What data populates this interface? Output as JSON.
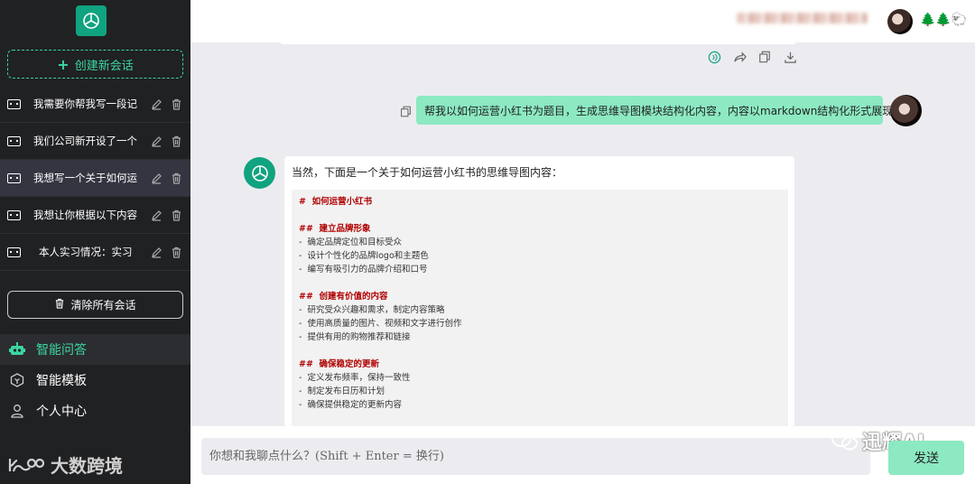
{
  "colors": {
    "accent": "#3bd6a1",
    "sidebar_bg": "#202123",
    "user_bubble": "#8ce9c2",
    "bot_green": "#10a37f",
    "heading_red": "#b00000"
  },
  "sidebar": {
    "new_chat_label": "创建新会话",
    "conversations": [
      {
        "label": "我需要你帮我写一段记"
      },
      {
        "label": "我们公司新开设了一个"
      },
      {
        "label": "我想写一个关于如何运"
      },
      {
        "label": "我想让你根据以下内容"
      },
      {
        "label": "本人实习情况：实习"
      }
    ],
    "clear_label": "清除所有会话",
    "menu": [
      {
        "label": "智能问答",
        "icon": "robot-icon"
      },
      {
        "label": "智能模板",
        "icon": "template-icon"
      },
      {
        "label": "个人中心",
        "icon": "user-icon"
      }
    ],
    "brand": "大数跨境"
  },
  "header": {
    "deco": "🌲🌲🐑"
  },
  "chat": {
    "user_message": "帮我以如何运营小红书为题目，生成思维导图模块结构化内容，内容以markdown结构化形式展现",
    "bot_intro": "当然，下面是一个关于如何运营小红书的思维导图内容：",
    "code_lines": [
      {
        "text": "#  如何运营小红书",
        "h": true
      },
      {
        "text": "",
        "h": false
      },
      {
        "text": "##  建立品牌形象",
        "h": true
      },
      {
        "text": "-  确定品牌定位和目标受众",
        "h": false
      },
      {
        "text": "-  设计个性化的品牌logo和主题色",
        "h": false
      },
      {
        "text": "-  编写有吸引力的品牌介绍和口号",
        "h": false
      },
      {
        "text": "",
        "h": false
      },
      {
        "text": "##  创建有价值的内容",
        "h": true
      },
      {
        "text": "-  研究受众兴趣和需求，制定内容策略",
        "h": false
      },
      {
        "text": "-  使用高质量的图片、视频和文字进行创作",
        "h": false
      },
      {
        "text": "-  提供有用的购物推荐和链接",
        "h": false
      },
      {
        "text": "",
        "h": false
      },
      {
        "text": "##  确保稳定的更新",
        "h": true
      },
      {
        "text": "-  定义发布频率，保持一致性",
        "h": false
      },
      {
        "text": "-  制定发布日历和计划",
        "h": false
      },
      {
        "text": "-  确保提供稳定的更新内容",
        "h": false
      }
    ]
  },
  "input": {
    "placeholder": "你想和我聊点什么？(Shift + Enter = 换行)",
    "send_label": "发送"
  },
  "watermark": "迅耀AI"
}
